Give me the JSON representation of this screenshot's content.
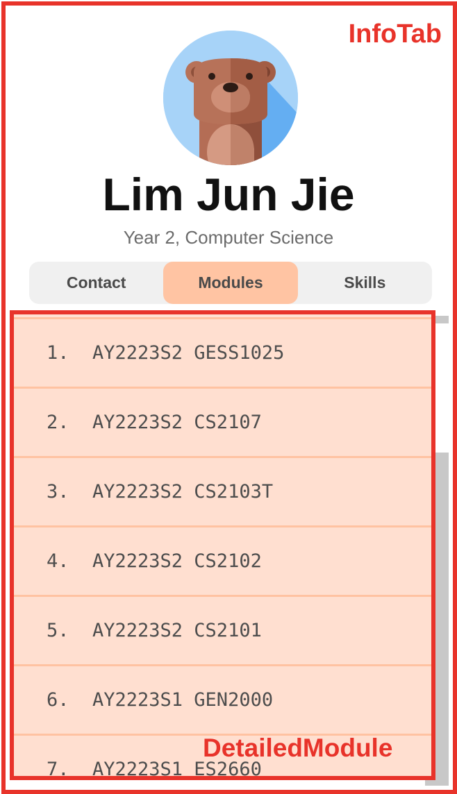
{
  "annotations": {
    "info_tab_label": "InfoTab",
    "detailed_module_label": "DetailedModule"
  },
  "profile": {
    "name": "Lim Jun Jie",
    "subtitle": "Year 2, Computer Science",
    "avatar_icon": "bear-avatar-icon"
  },
  "tabs": [
    {
      "label": "Contact",
      "active": false
    },
    {
      "label": "Modules",
      "active": true
    },
    {
      "label": "Skills",
      "active": false
    }
  ],
  "modules": [
    {
      "index": "1.",
      "code": "AY2223S2 GESS1025"
    },
    {
      "index": "2.",
      "code": "AY2223S2 CS2107"
    },
    {
      "index": "3.",
      "code": "AY2223S2 CS2103T"
    },
    {
      "index": "4.",
      "code": "AY2223S2 CS2102"
    },
    {
      "index": "5.",
      "code": "AY2223S2 CS2101"
    },
    {
      "index": "6.",
      "code": "AY2223S1 GEN2000"
    },
    {
      "index": "7.",
      "code": "AY2223S1 ES2660"
    }
  ],
  "colors": {
    "annotation_red": "#e8332a",
    "active_tab": "#ffc4a3",
    "module_row_bg": "#ffdfd0",
    "module_row_border": "#ffc2a1"
  }
}
